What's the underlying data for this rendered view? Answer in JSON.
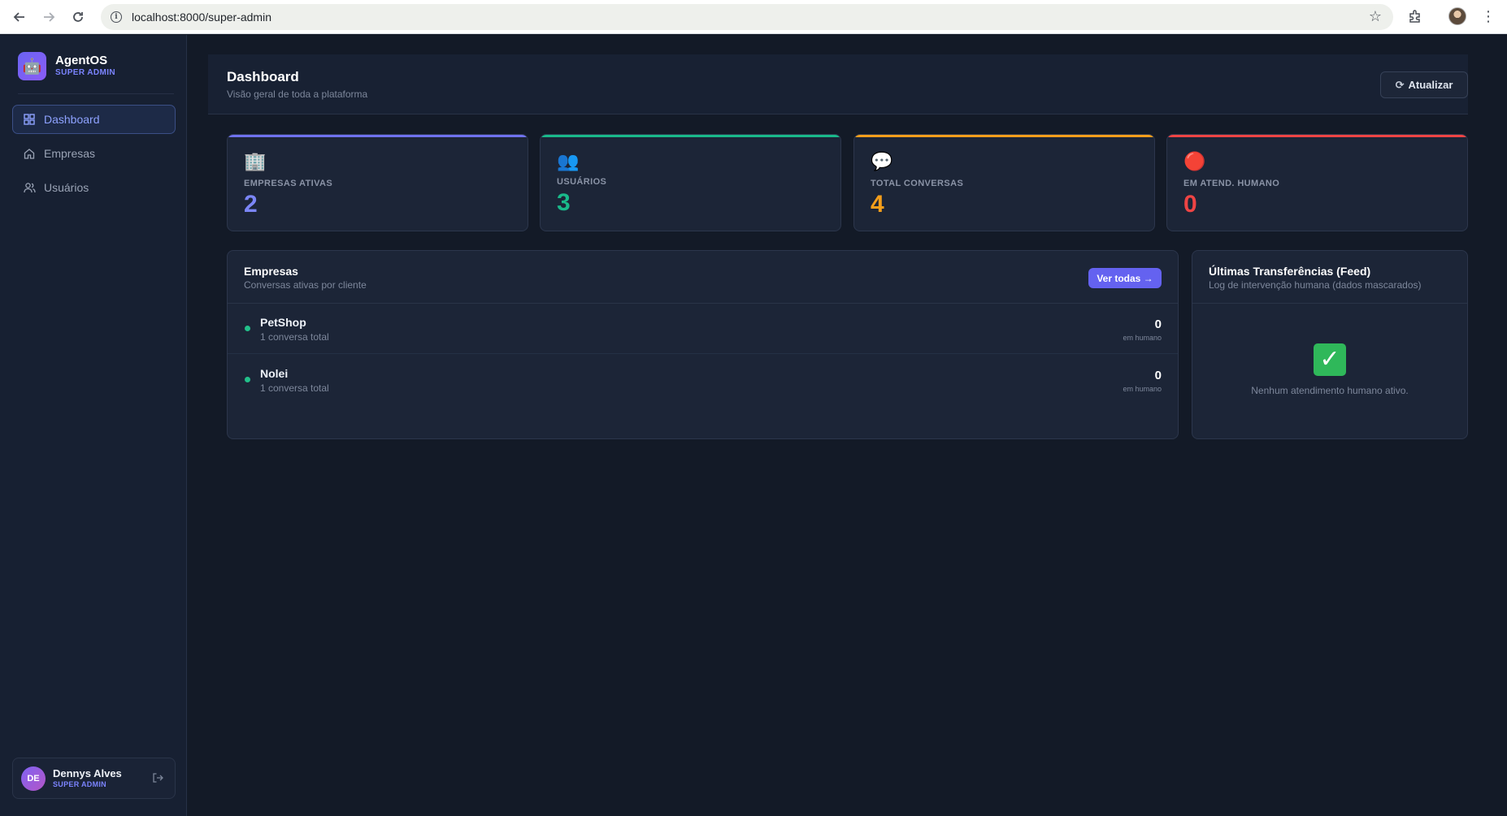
{
  "browser": {
    "url": "localhost:8000/super-admin"
  },
  "sidebar": {
    "brand_name": "AgentOS",
    "brand_role": "SUPER ADMIN",
    "items": [
      {
        "label": "Dashboard",
        "icon": "grid-icon",
        "active": true
      },
      {
        "label": "Empresas",
        "icon": "home-icon",
        "active": false
      },
      {
        "label": "Usuários",
        "icon": "users-icon",
        "active": false
      }
    ],
    "user": {
      "initials": "DE",
      "name": "Dennys Alves",
      "role": "SUPER ADMIN"
    }
  },
  "header": {
    "title": "Dashboard",
    "subtitle": "Visão geral de toda a plataforma",
    "refresh_label": "Atualizar"
  },
  "stats": [
    {
      "label": "EMPRESAS ATIVAS",
      "value": "2",
      "icon": "building-icon",
      "color": "#7b86f6"
    },
    {
      "label": "USUÁRIOS",
      "value": "3",
      "icon": "users-emoji-icon",
      "color": "#19b98a"
    },
    {
      "label": "TOTAL CONVERSAS",
      "value": "4",
      "icon": "speech-bubble-icon",
      "color": "#f59e1b"
    },
    {
      "label": "EM ATEND. HUMANO",
      "value": "0",
      "icon": "red-circle-icon",
      "color": "#ef4444"
    }
  ],
  "companies_panel": {
    "title": "Empresas",
    "subtitle": "Conversas ativas por cliente",
    "view_all_label": "Ver todas →",
    "rows": [
      {
        "name": "PetShop",
        "sub": "1 conversa total",
        "count": "0",
        "count_label": "em humano"
      },
      {
        "name": "Nolei",
        "sub": "1 conversa total",
        "count": "0",
        "count_label": "em humano"
      }
    ]
  },
  "feed_panel": {
    "title": "Últimas Transferências (Feed)",
    "subtitle": "Log de intervenção humana (dados mascarados)",
    "empty_text": "Nenhum atendimento humano ativo."
  }
}
